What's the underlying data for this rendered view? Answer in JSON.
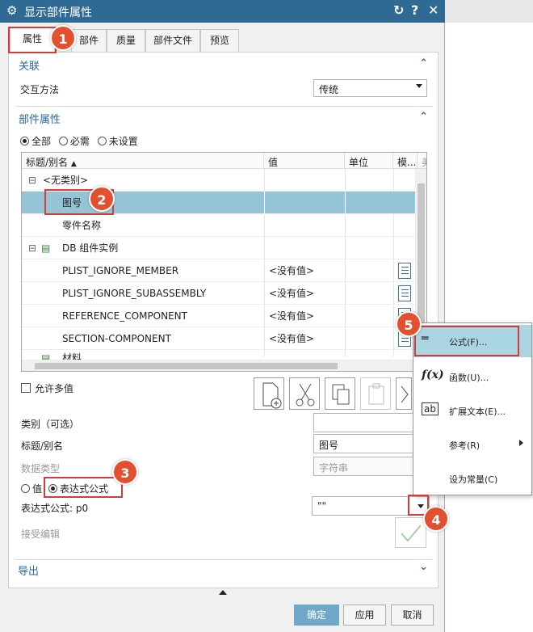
{
  "window": {
    "title": "显示部件属性",
    "reset_icon": "reset-icon",
    "help_label": "?",
    "close_label": "✕"
  },
  "tabs": [
    "属性",
    "部件",
    "质量",
    "部件文件",
    "预览"
  ],
  "sections": {
    "association": "关联",
    "part_attributes": "部件属性",
    "export": "导出"
  },
  "interaction": {
    "label": "交互方法",
    "value": "传统"
  },
  "filter": {
    "all": "全部",
    "required": "必需",
    "unset": "未设置",
    "selected": "all"
  },
  "table": {
    "columns": [
      "标题/别名",
      "值",
      "单位",
      "模...",
      "美"
    ],
    "rows": [
      {
        "title": "<无类别>",
        "value": "",
        "kind": "group"
      },
      {
        "title": "图号",
        "value": "",
        "kind": "item",
        "selected": true
      },
      {
        "title": "零件名称",
        "value": "",
        "kind": "item"
      },
      {
        "title": "DB 组件实例",
        "value": "",
        "kind": "group"
      },
      {
        "title": "PLIST_IGNORE_MEMBER",
        "value": "<没有值>",
        "kind": "item"
      },
      {
        "title": "PLIST_IGNORE_SUBASSEMBLY",
        "value": "<没有值>",
        "kind": "item"
      },
      {
        "title": "REFERENCE_COMPONENT",
        "value": "<没有值>",
        "kind": "item"
      },
      {
        "title": "SECTION-COMPONENT",
        "value": "<没有值>",
        "kind": "item"
      },
      {
        "title": "材料",
        "value": "",
        "kind": "group"
      }
    ]
  },
  "allow_multi": "允许多值",
  "form": {
    "category_label": "类别（可选）",
    "category_value": "",
    "title_label": "标题/别名",
    "title_value": "图号",
    "datatype_label": "数据类型",
    "datatype_value": "字符串",
    "radio_value": "值",
    "radio_expr": "表达式公式",
    "expr_label": "表达式公式: p0",
    "expr_value": "\"\"",
    "accept_label": "接受编辑"
  },
  "buttons": {
    "ok": "确定",
    "apply": "应用",
    "cancel": "取消"
  },
  "menu": [
    {
      "label": "公式(F)...",
      "icon": "equals-icon"
    },
    {
      "label": "函数(U)...",
      "icon": "function-icon"
    },
    {
      "label": "扩展文本(E)...",
      "icon": "text-box-icon"
    },
    {
      "label": "参考(R)",
      "icon": "none"
    },
    {
      "label": "设为常量(C)",
      "icon": "none"
    }
  ],
  "callouts": [
    "1",
    "2",
    "3",
    "4",
    "5"
  ],
  "colors": {
    "titlebar": "#2e6a93",
    "accent": "#2b6aa0",
    "selection": "#95c4d6",
    "callout": "#e2502f",
    "highlight": "#a9d6e2",
    "primary_button": "#6fa8c9"
  }
}
